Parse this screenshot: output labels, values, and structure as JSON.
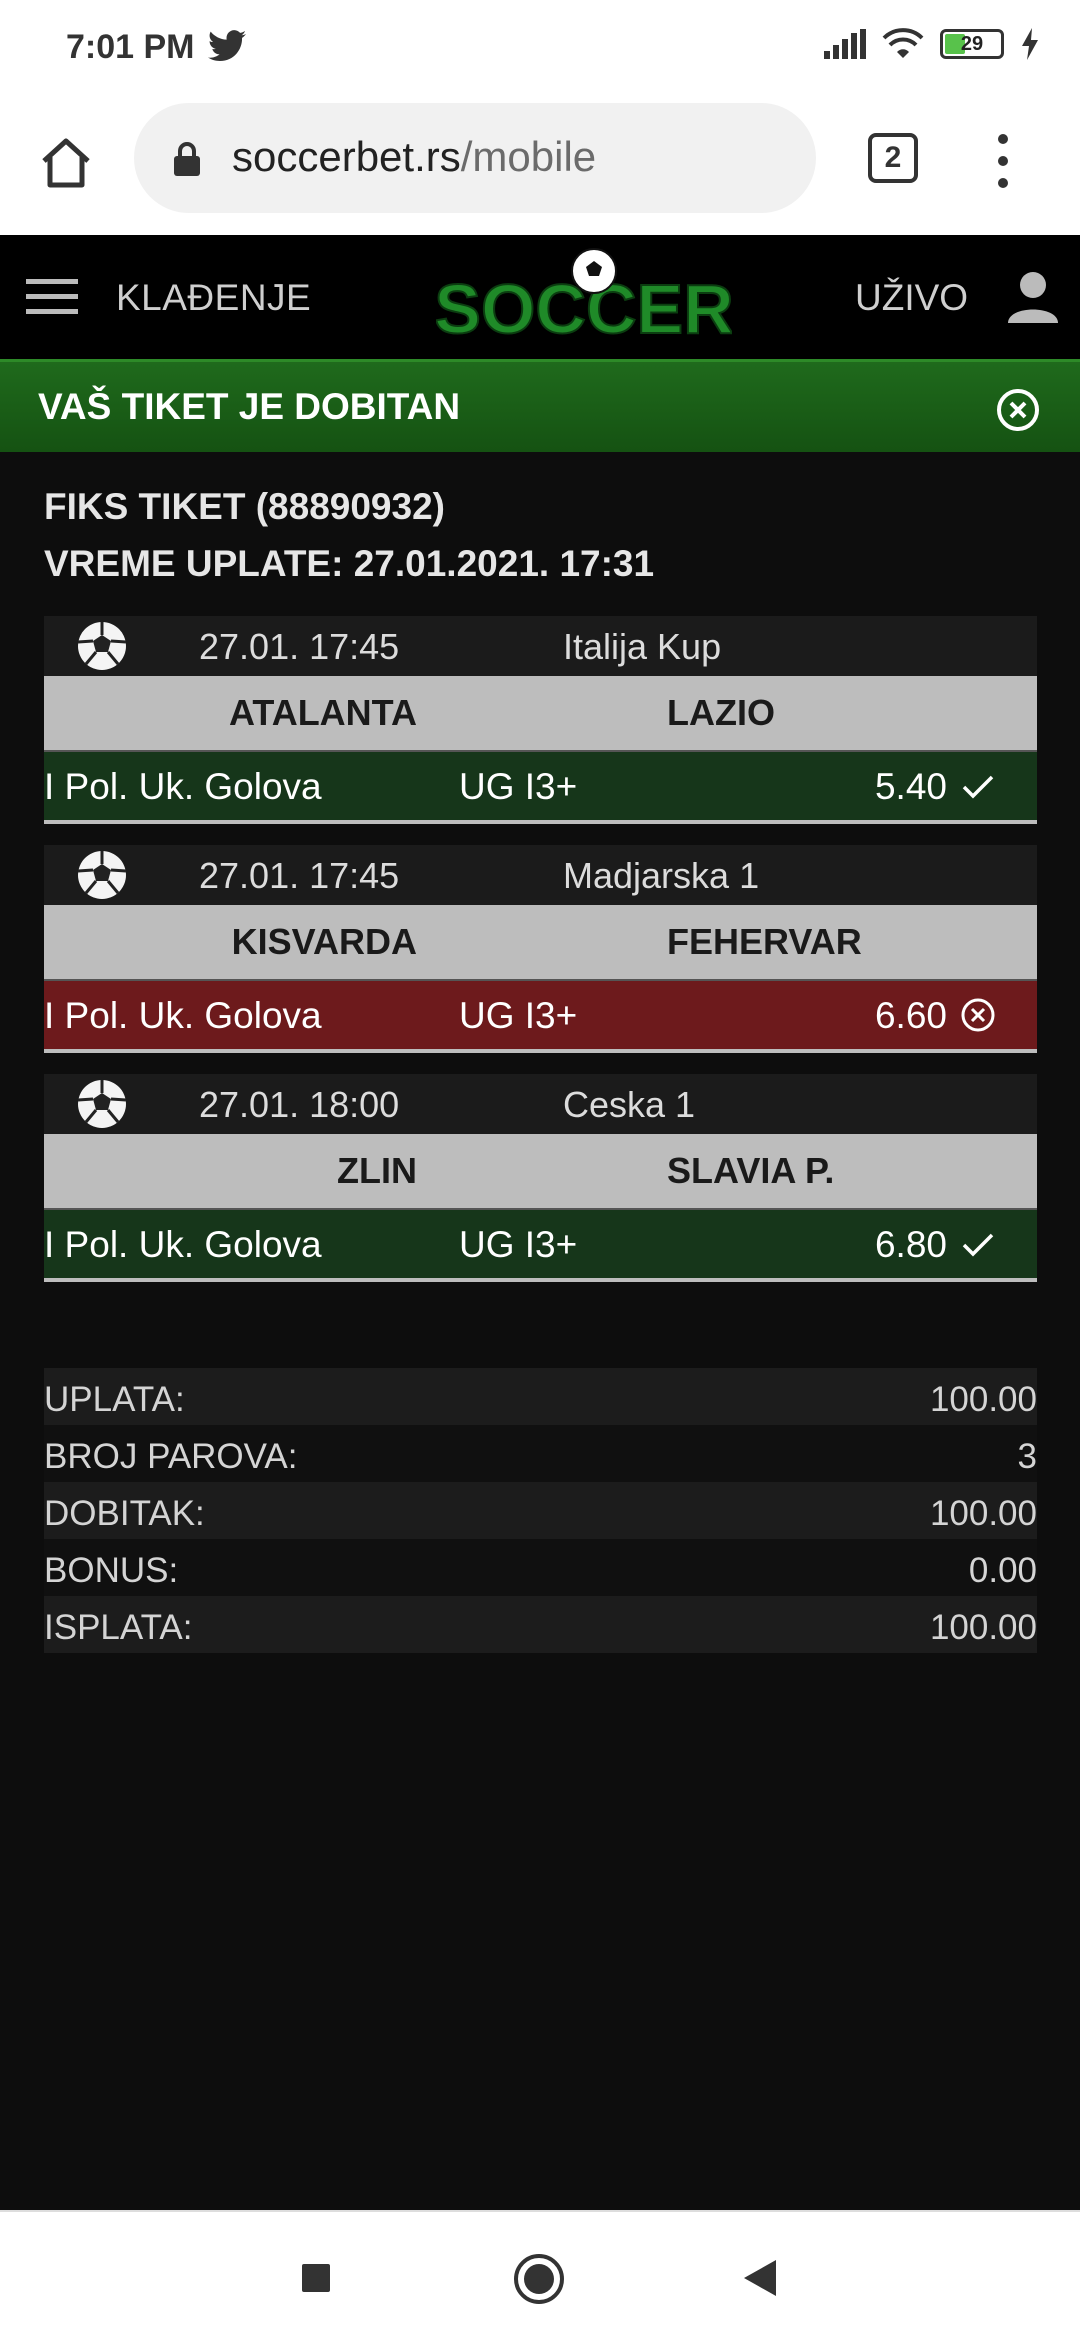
{
  "status_bar": {
    "time": "7:01 PM",
    "battery": "29"
  },
  "browser": {
    "url_domain": "soccerbet.rs",
    "url_path": "/mobile",
    "tab_count": "2"
  },
  "site_header": {
    "nav_left": "KLAĐENJE",
    "nav_right": "UŽIVO",
    "logo_text": "SOCCER"
  },
  "banner": {
    "text": "VAŠ TIKET JE DOBITAN"
  },
  "ticket": {
    "title": "FIKS TIKET (88890932)",
    "time": "VREME UPLATE: 27.01.2021. 17:31"
  },
  "matches": [
    {
      "date": "27.01. 17:45",
      "league": "Italija Kup",
      "home": "ATALANTA",
      "away": "LAZIO",
      "market": "I Pol. Uk. Golova",
      "pick": "UG I3+",
      "odd": "5.40",
      "result": "win"
    },
    {
      "date": "27.01. 17:45",
      "league": "Madjarska 1",
      "home": "KISVARDA",
      "away": "FEHERVAR",
      "market": "I Pol. Uk. Golova",
      "pick": "UG I3+",
      "odd": "6.60",
      "result": "lose"
    },
    {
      "date": "27.01. 18:00",
      "league": "Ceska 1",
      "home": "ZLIN",
      "away": "SLAVIA P.",
      "market": "I Pol. Uk. Golova",
      "pick": "UG I3+",
      "odd": "6.80",
      "result": "win"
    }
  ],
  "summary": [
    {
      "label": "UPLATA:",
      "value": "100.00"
    },
    {
      "label": "BROJ PAROVA:",
      "value": "3"
    },
    {
      "label": "DOBITAK:",
      "value": "100.00"
    },
    {
      "label": "BONUS:",
      "value": "0.00"
    },
    {
      "label": "ISPLATA:",
      "value": "100.00"
    }
  ],
  "colors": {
    "win": "#16361a",
    "lose": "#6d1a1c",
    "banner": "#1f6a1c",
    "logo": "#1f8a28"
  }
}
